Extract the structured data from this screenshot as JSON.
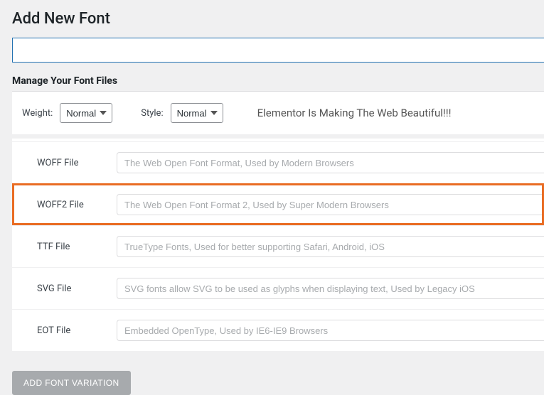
{
  "pageTitle": "Add New Font",
  "sectionHeading": "Manage Your Font Files",
  "controls": {
    "weightLabel": "Weight:",
    "weightValue": "Normal",
    "styleLabel": "Style:",
    "styleValue": "Normal"
  },
  "previewText": "Elementor Is Making The Web Beautiful!!!",
  "fileRows": [
    {
      "label": "WOFF File",
      "placeholder": "The Web Open Font Format, Used by Modern Browsers",
      "highlighted": false
    },
    {
      "label": "WOFF2 File",
      "placeholder": "The Web Open Font Format 2, Used by Super Modern Browsers",
      "highlighted": true
    },
    {
      "label": "TTF File",
      "placeholder": "TrueType Fonts, Used for better supporting Safari, Android, iOS",
      "highlighted": false
    },
    {
      "label": "SVG File",
      "placeholder": "SVG fonts allow SVG to be used as glyphs when displaying text, Used by Legacy iOS",
      "highlighted": false
    },
    {
      "label": "EOT File",
      "placeholder": "Embedded OpenType, Used by IE6-IE9 Browsers",
      "highlighted": false
    }
  ],
  "addVariationLabel": "ADD FONT VARIATION"
}
